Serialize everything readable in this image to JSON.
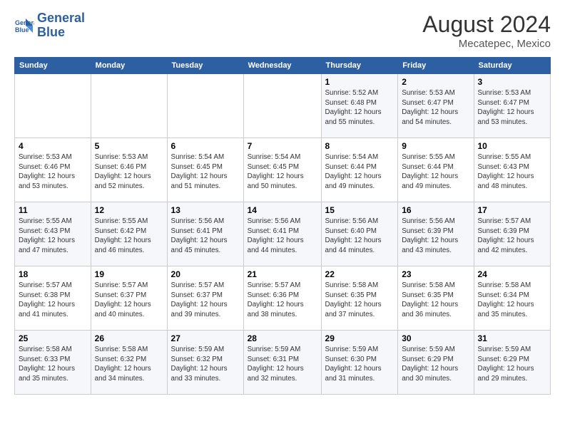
{
  "header": {
    "logo_line1": "General",
    "logo_line2": "Blue",
    "month_year": "August 2024",
    "location": "Mecatepec, Mexico"
  },
  "days_of_week": [
    "Sunday",
    "Monday",
    "Tuesday",
    "Wednesday",
    "Thursday",
    "Friday",
    "Saturday"
  ],
  "weeks": [
    [
      {
        "day": "",
        "info": ""
      },
      {
        "day": "",
        "info": ""
      },
      {
        "day": "",
        "info": ""
      },
      {
        "day": "",
        "info": ""
      },
      {
        "day": "1",
        "info": "Sunrise: 5:52 AM\nSunset: 6:48 PM\nDaylight: 12 hours\nand 55 minutes."
      },
      {
        "day": "2",
        "info": "Sunrise: 5:53 AM\nSunset: 6:47 PM\nDaylight: 12 hours\nand 54 minutes."
      },
      {
        "day": "3",
        "info": "Sunrise: 5:53 AM\nSunset: 6:47 PM\nDaylight: 12 hours\nand 53 minutes."
      }
    ],
    [
      {
        "day": "4",
        "info": "Sunrise: 5:53 AM\nSunset: 6:46 PM\nDaylight: 12 hours\nand 53 minutes."
      },
      {
        "day": "5",
        "info": "Sunrise: 5:53 AM\nSunset: 6:46 PM\nDaylight: 12 hours\nand 52 minutes."
      },
      {
        "day": "6",
        "info": "Sunrise: 5:54 AM\nSunset: 6:45 PM\nDaylight: 12 hours\nand 51 minutes."
      },
      {
        "day": "7",
        "info": "Sunrise: 5:54 AM\nSunset: 6:45 PM\nDaylight: 12 hours\nand 50 minutes."
      },
      {
        "day": "8",
        "info": "Sunrise: 5:54 AM\nSunset: 6:44 PM\nDaylight: 12 hours\nand 49 minutes."
      },
      {
        "day": "9",
        "info": "Sunrise: 5:55 AM\nSunset: 6:44 PM\nDaylight: 12 hours\nand 49 minutes."
      },
      {
        "day": "10",
        "info": "Sunrise: 5:55 AM\nSunset: 6:43 PM\nDaylight: 12 hours\nand 48 minutes."
      }
    ],
    [
      {
        "day": "11",
        "info": "Sunrise: 5:55 AM\nSunset: 6:43 PM\nDaylight: 12 hours\nand 47 minutes."
      },
      {
        "day": "12",
        "info": "Sunrise: 5:55 AM\nSunset: 6:42 PM\nDaylight: 12 hours\nand 46 minutes."
      },
      {
        "day": "13",
        "info": "Sunrise: 5:56 AM\nSunset: 6:41 PM\nDaylight: 12 hours\nand 45 minutes."
      },
      {
        "day": "14",
        "info": "Sunrise: 5:56 AM\nSunset: 6:41 PM\nDaylight: 12 hours\nand 44 minutes."
      },
      {
        "day": "15",
        "info": "Sunrise: 5:56 AM\nSunset: 6:40 PM\nDaylight: 12 hours\nand 44 minutes."
      },
      {
        "day": "16",
        "info": "Sunrise: 5:56 AM\nSunset: 6:39 PM\nDaylight: 12 hours\nand 43 minutes."
      },
      {
        "day": "17",
        "info": "Sunrise: 5:57 AM\nSunset: 6:39 PM\nDaylight: 12 hours\nand 42 minutes."
      }
    ],
    [
      {
        "day": "18",
        "info": "Sunrise: 5:57 AM\nSunset: 6:38 PM\nDaylight: 12 hours\nand 41 minutes."
      },
      {
        "day": "19",
        "info": "Sunrise: 5:57 AM\nSunset: 6:37 PM\nDaylight: 12 hours\nand 40 minutes."
      },
      {
        "day": "20",
        "info": "Sunrise: 5:57 AM\nSunset: 6:37 PM\nDaylight: 12 hours\nand 39 minutes."
      },
      {
        "day": "21",
        "info": "Sunrise: 5:57 AM\nSunset: 6:36 PM\nDaylight: 12 hours\nand 38 minutes."
      },
      {
        "day": "22",
        "info": "Sunrise: 5:58 AM\nSunset: 6:35 PM\nDaylight: 12 hours\nand 37 minutes."
      },
      {
        "day": "23",
        "info": "Sunrise: 5:58 AM\nSunset: 6:35 PM\nDaylight: 12 hours\nand 36 minutes."
      },
      {
        "day": "24",
        "info": "Sunrise: 5:58 AM\nSunset: 6:34 PM\nDaylight: 12 hours\nand 35 minutes."
      }
    ],
    [
      {
        "day": "25",
        "info": "Sunrise: 5:58 AM\nSunset: 6:33 PM\nDaylight: 12 hours\nand 35 minutes."
      },
      {
        "day": "26",
        "info": "Sunrise: 5:58 AM\nSunset: 6:32 PM\nDaylight: 12 hours\nand 34 minutes."
      },
      {
        "day": "27",
        "info": "Sunrise: 5:59 AM\nSunset: 6:32 PM\nDaylight: 12 hours\nand 33 minutes."
      },
      {
        "day": "28",
        "info": "Sunrise: 5:59 AM\nSunset: 6:31 PM\nDaylight: 12 hours\nand 32 minutes."
      },
      {
        "day": "29",
        "info": "Sunrise: 5:59 AM\nSunset: 6:30 PM\nDaylight: 12 hours\nand 31 minutes."
      },
      {
        "day": "30",
        "info": "Sunrise: 5:59 AM\nSunset: 6:29 PM\nDaylight: 12 hours\nand 30 minutes."
      },
      {
        "day": "31",
        "info": "Sunrise: 5:59 AM\nSunset: 6:29 PM\nDaylight: 12 hours\nand 29 minutes."
      }
    ]
  ]
}
